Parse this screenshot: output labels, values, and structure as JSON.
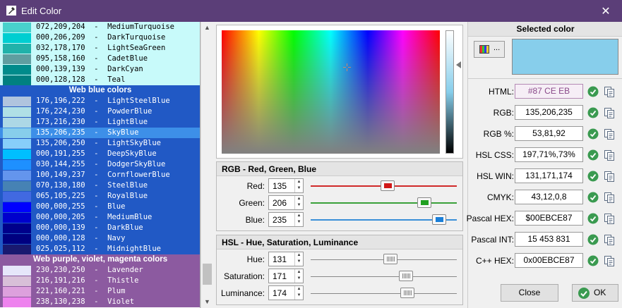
{
  "window": {
    "title": "Edit Color",
    "close_glyph": "✕"
  },
  "colors": {
    "accent": "#5b3e78",
    "teal_group_bg": "#c8fafa",
    "blue_group_bg": "#2159c5",
    "purple_group_bg": "#8c5aa0",
    "selected_row_bg": "#3d8fe8"
  },
  "color_list": {
    "teal_rows": [
      {
        "text": "072,209,204  -  MediumTurquoise",
        "swatch": "#48d1cc"
      },
      {
        "text": "000,206,209  -  DarkTurquoise",
        "swatch": "#00ced1"
      },
      {
        "text": "032,178,170  -  LightSeaGreen",
        "swatch": "#20b2aa"
      },
      {
        "text": "095,158,160  -  CadetBlue",
        "swatch": "#5f9ea0"
      },
      {
        "text": "000,139,139  -  DarkCyan",
        "swatch": "#008b8b"
      },
      {
        "text": "000,128,128  -  Teal",
        "swatch": "#008080"
      }
    ],
    "blue_group_label": "Web blue colors",
    "blue_rows": [
      {
        "text": "176,196,222  -  LightSteelBlue",
        "swatch": "#b0c4de"
      },
      {
        "text": "176,224,230  -  PowderBlue",
        "swatch": "#b0e0e6"
      },
      {
        "text": "173,216,230  -  LightBlue",
        "swatch": "#add8e6"
      },
      {
        "text": "135,206,235  -  SkyBlue",
        "swatch": "#87ceeb",
        "selected": true
      },
      {
        "text": "135,206,250  -  LightSkyBlue",
        "swatch": "#87cefa"
      },
      {
        "text": "000,191,255  -  DeepSkyBlue",
        "swatch": "#00bfff"
      },
      {
        "text": "030,144,255  -  DodgerSkyBlue",
        "swatch": "#1e90ff"
      },
      {
        "text": "100,149,237  -  CornflowerBlue",
        "swatch": "#6495ed"
      },
      {
        "text": "070,130,180  -  SteelBlue",
        "swatch": "#4682b4"
      },
      {
        "text": "065,105,225  -  RoyalBlue",
        "swatch": "#4169e1"
      },
      {
        "text": "000,000,255  -  Blue",
        "swatch": "#0000ff"
      },
      {
        "text": "000,000,205  -  MediumBlue",
        "swatch": "#0000cd"
      },
      {
        "text": "000,000,139  -  DarkBlue",
        "swatch": "#00008b"
      },
      {
        "text": "000,000,128  -  Navy",
        "swatch": "#000080"
      },
      {
        "text": "025,025,112  -  MidnightBlue",
        "swatch": "#191970"
      }
    ],
    "purple_group_label": "Web purple, violet, magenta colors",
    "purple_rows": [
      {
        "text": "230,230,250  -  Lavender",
        "swatch": "#e6e6fa"
      },
      {
        "text": "216,191,216  -  Thistle",
        "swatch": "#d8bfd8"
      },
      {
        "text": "221,160,221  -  Plum",
        "swatch": "#dda0dd"
      },
      {
        "text": "238,130,238  -  Violet",
        "swatch": "#ee82ee"
      }
    ]
  },
  "scrollbar": {
    "up_glyph": "▲",
    "down_glyph": "▼"
  },
  "rgb_group": {
    "title": "RGB - Red, Green, Blue",
    "rows": [
      {
        "label": "Red:",
        "value": "135",
        "level": 0.529,
        "color": "#d01818",
        "track": "#d02a2a"
      },
      {
        "label": "Green:",
        "value": "206",
        "level": 0.808,
        "color": "#20a020",
        "track": "#3aa03a"
      },
      {
        "label": "Blue:",
        "value": "235",
        "level": 0.922,
        "color": "#1a7fd8",
        "track": "#3a8fd8"
      }
    ]
  },
  "hsl_group": {
    "title": "HSL - Hue, Saturation, Luminance",
    "rows": [
      {
        "label": "Hue:",
        "value": "131",
        "level": 0.55
      },
      {
        "label": "Saturation:",
        "value": "171",
        "level": 0.67
      },
      {
        "label": "Luminance:",
        "value": "174",
        "level": 0.68
      }
    ]
  },
  "selected": {
    "header": "Selected color",
    "picker_dots": "...",
    "color": "#87ceeb",
    "formats": [
      {
        "label": "HTML:",
        "value": "#87 CE EB"
      },
      {
        "label": "RGB:",
        "value": "135,206,235"
      },
      {
        "label": "RGB %:",
        "value": "53,81,92"
      },
      {
        "label": "HSL CSS:",
        "value": "197,71%,73%"
      },
      {
        "label": "HSL WIN:",
        "value": "131,171,174"
      },
      {
        "label": "CMYK:",
        "value": "43,12,0,8"
      },
      {
        "label": "Pascal HEX:",
        "value": "$00EBCE87"
      },
      {
        "label": "Pascal INT:",
        "value": "15 453 831"
      },
      {
        "label": "C++ HEX:",
        "value": "0x00EBCE87"
      }
    ]
  },
  "buttons": {
    "close_label": "Close",
    "ok_label": "OK"
  }
}
